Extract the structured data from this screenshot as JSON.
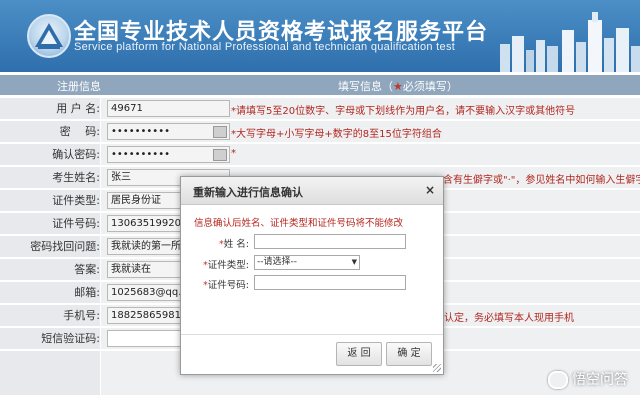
{
  "header": {
    "title": "全国专业技术人员资格考试报名服务平台",
    "subtitle": "Service platform for National Professional and technician  qualification test"
  },
  "table_head": {
    "left": "注册信息",
    "right": "填写信息（",
    "required_star": "★",
    "required_text": "必须填写）"
  },
  "rows": [
    {
      "label": "用 户 名:",
      "value": "49671",
      "hint": "*请填写5至20位数字、字母或下划线作为用户名，请不要输入汉字或其他符号"
    },
    {
      "label": "密　 码:",
      "value": "••••••••••",
      "hint": "*大写字母+小写字母+数字的8至15位字符组合"
    },
    {
      "label": "确认密码:",
      "value": "••••••••••",
      "hint": "*"
    },
    {
      "label": "考生姓名:",
      "value": "张三",
      "hint": "含有生僻字或\"·\"，参见姓名中如何输入生僻字"
    },
    {
      "label": "证件类型:",
      "value": "居民身份证"
    },
    {
      "label": "证件号码:",
      "value": "13063519920522"
    },
    {
      "label": "密码找回问题:",
      "value": "我就读的第一所学"
    },
    {
      "label": "答案:",
      "value": "我就读在"
    },
    {
      "label": "邮箱:",
      "value": "1025683@qq.co"
    },
    {
      "label": "手机号:",
      "value": "18825865981",
      "hint": "认定，务必填写本人现用手机"
    },
    {
      "label": "短信验证码:",
      "value": ""
    }
  ],
  "dialog": {
    "title": "重新输入进行信息确认",
    "close": "×",
    "notice": "信息确认后姓名、证件类型和证件号码将不能修改",
    "name_label": "姓 名:",
    "idtype_label": "证件类型:",
    "idtype_value": "--请选择--",
    "idno_label": "证件号码:",
    "req_mark": "*",
    "back_button": "返 回",
    "ok_button": "确 定"
  },
  "watermark": "悟空问答"
}
